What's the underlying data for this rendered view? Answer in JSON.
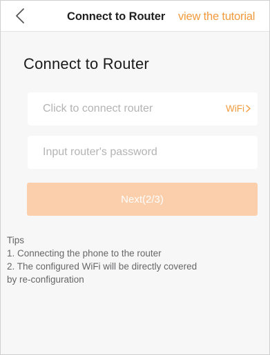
{
  "header": {
    "back_icon": "chevron-left-icon",
    "title": "Connect to Router",
    "tutorial_link": "view the tutorial"
  },
  "main": {
    "title": "Connect to Router",
    "router_field": {
      "placeholder": "Click to connect router",
      "wifi_label": "WiFi",
      "wifi_icon": "chevron-right-icon"
    },
    "password_field": {
      "placeholder": "Input router's password",
      "value": ""
    },
    "next_button": "Next(2/3)",
    "tips": {
      "heading": "Tips",
      "line1": "1. Connecting the phone to the router",
      "line2": "2. The configured WiFi will be directly covered",
      "line3": "by re-configuration"
    }
  },
  "colors": {
    "accent": "#f19a3c",
    "button_disabled": "#fbcfab",
    "background": "#f7f7f8"
  }
}
